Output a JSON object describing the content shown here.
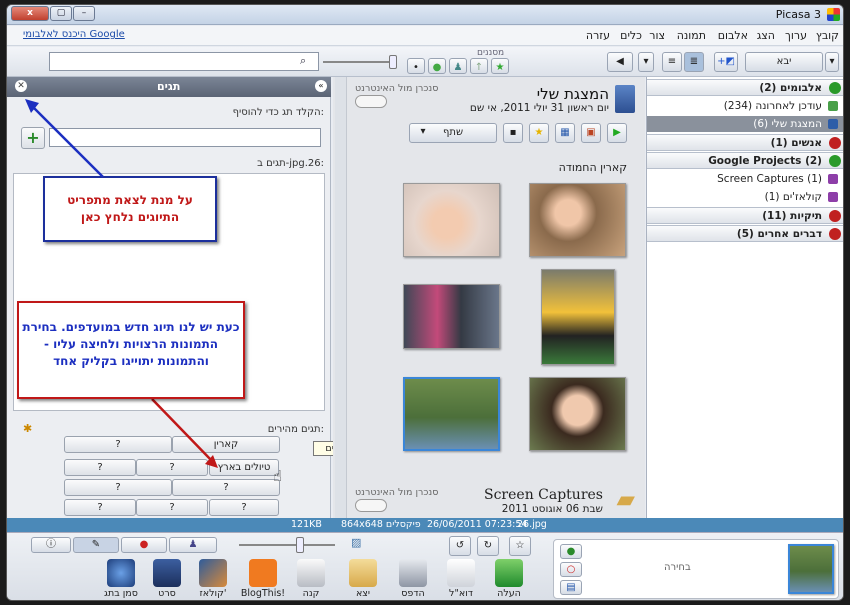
{
  "window": {
    "title": "Picasa 3",
    "close_label": "x",
    "max_label": "▢",
    "min_label": "–"
  },
  "menu": {
    "items": [
      "קובץ",
      "ערוך",
      "הצג",
      "אלבום",
      "תמונה",
      "צור",
      "כלים",
      "עזרה"
    ],
    "google_link": "היכנס לאלבומי Google"
  },
  "toolbar": {
    "import_label": "יבא",
    "filters_label": "מסננים"
  },
  "tags_panel": {
    "title": "תגים",
    "add_hint": "הקלד תג כדי להוסיף:",
    "add_button": "+",
    "photo_tags_label": "תגים ב-jpg.26:",
    "quick_tags_label": "תגים מהירים:",
    "quick_tags": [
      "קארין",
      "?",
      "טיולים בארץ",
      "?",
      "?",
      "?",
      "?",
      "?",
      "?",
      "?",
      "?"
    ]
  },
  "callouts": {
    "blue": "על מנת לצאת מתפריט התיוגים נלחץ כאן",
    "red": "כעת יש לנו תיוג חדש במועדפים. בחירת התמונות הרצויות ולחיצה עליו - והתמונות יתוייגו בקליק אחד"
  },
  "tooltip": "הוסף תג: טיולים בארץ",
  "album": {
    "title": "המצגת שלי",
    "date": "יום ראשון 31 יולי 2011, אי שם",
    "sync_label": "סנכרן מול האינטרנט",
    "share_label": "שתף",
    "caption": "קארין החמודה"
  },
  "album2": {
    "title": "Screen Captures",
    "date": "שבת 06 אוגוסט 2011",
    "sync_label": "סנכרן מול האינטרנט"
  },
  "library": {
    "sections": [
      {
        "label": "אלבומים (2)",
        "open": true
      },
      {
        "label": "עודכן לאחרונה (234)"
      },
      {
        "label": "המצגת שלי (6)"
      },
      {
        "label": "אנשים (1)"
      },
      {
        "label": "Google Projects (2)"
      },
      {
        "label": "Screen Captures (1)"
      },
      {
        "label": "קולאז'ים (1)"
      },
      {
        "label": "תיקיות (11)"
      },
      {
        "label": "דברים אחרים (5)"
      }
    ]
  },
  "status": {
    "file": "26.jpg",
    "datetime": "26/06/2011 07:23:54",
    "dimensions": "864x648 פיקסלים",
    "size": "121KB"
  },
  "bottom": {
    "selection_label": "בחירה",
    "actions": [
      "העלה",
      "דוא\"ל",
      "הדפס",
      "יצא",
      "קנה",
      "BlogThis!",
      "קולאז'",
      "סרט",
      "סמן בתג גיאוגרפי"
    ]
  },
  "colors": {
    "status_bar": "#4b89b8",
    "panel_header": "#6b7586",
    "callout_border": "#1c2f9c",
    "callout_text": "#c01818"
  }
}
